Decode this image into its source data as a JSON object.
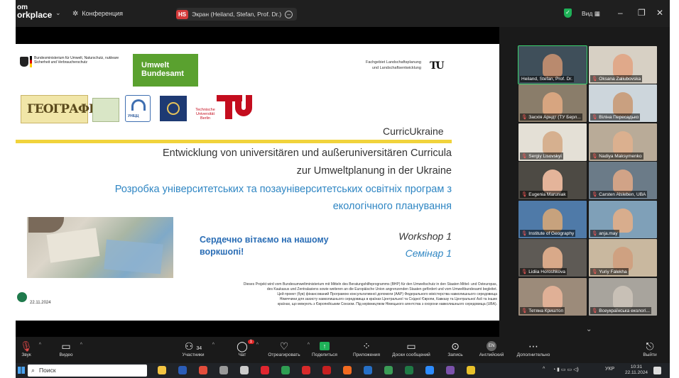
{
  "app": {
    "brand_line1": "om",
    "brand_line2": "orkplace",
    "meeting_label": "Конференция",
    "share_badge": "HS",
    "share_title": "Экран (Heiland, Stefan, Prof. Dr.)",
    "view_label": "Вид"
  },
  "slide": {
    "bmu_text": "Bundesministerium für Umwelt, Naturschutz, nukleare Sicherheit und Verbraucherschutz",
    "uba_line1": "Umwelt",
    "uba_line2": "Bundesamt",
    "fg_line1": "Fachgebiet Landschaftsplanung",
    "fg_line2": "und Landschaftsentwicklung",
    "tub_small": "TU",
    "geo_logo": "ГЕОГРАФІ",
    "logo_b_text": "УНІЦЦ",
    "tu_text": "Technische Universität Berlin",
    "curric": "CurricUkraine",
    "de_line1": "Entwicklung von universitären und außeruniversitären Curricula",
    "de_line2": "zur Umweltplanung in der Ukraine",
    "ua_line1": "Розробка університетських та позауніверситетських освітніх програм з",
    "ua_line2": "екологічного планування",
    "welcome_line1": "Сердечно вітаємо на нашому",
    "welcome_line2": "воркшопі!",
    "workshop_de": "Workshop 1",
    "workshop_ua": "Семінар 1",
    "fine_1": "Dieses Projekt wird vom Bundesumweltministerium mit Mitteln des Beratungshilfeprogramms (BHP) für den Umweltschutz in den Staaten Mittel- und Osteuropas,",
    "fine_2": "des Kaukasus und Zentralasiens sowie weiteren an die Europäische Union angrenzenden Staaten gefördert und vom Umweltbundesamt begleitet.",
    "fine_3": "Цей проект (був) фінансований Програмою консультативної допомоги (ААР) Федерального міністерства навколишнього середовища",
    "fine_4": "Німеччини для захисту навколишнього середовища в країнах Центральної та Східної Європи, Кавказу та Центральної Азії та інших",
    "fine_5": "країнах, що межують з Європейським Союзом. Під керівництвом Німецького агентства з охорони навколишнього середовища (UBA).",
    "date": "22.11.2024"
  },
  "participants": [
    {
      "name": "Heiland, Stefan, Prof. Dr.",
      "muted": false,
      "bg": "#3f4f5a",
      "face": "#b98a6e"
    },
    {
      "name": "Oksana Zaliubovska",
      "muted": true,
      "bg": "#d7d0c4",
      "face": "#e0a98a"
    },
    {
      "name": "Засхія Арндт (ТУ Берл...",
      "muted": true,
      "bg": "#8a7d6a",
      "face": "#d7a580"
    },
    {
      "name": "Віліна Пересадько",
      "muted": true,
      "bg": "#cdd6dc",
      "face": "#c9a080"
    },
    {
      "name": "Sergiy Lisovskyi",
      "muted": true,
      "bg": "#e4e0d6",
      "face": "#d6b08f"
    },
    {
      "name": "Nadiya Maksymenko",
      "muted": true,
      "bg": "#b9ab98",
      "face": "#dbb08f"
    },
    {
      "name": "Eugenia Maruniak",
      "muted": true,
      "bg": "#4d4a44",
      "face": "#e4b49a"
    },
    {
      "name": "Carsten Alsleben, UBA",
      "muted": true,
      "bg": "#6b7b88",
      "face": "#d1a387"
    },
    {
      "name": "Institute of Geography",
      "muted": true,
      "bg": "#4f7aa8",
      "face": "#c7a27d"
    },
    {
      "name": "anja.may",
      "muted": true,
      "bg": "#7fa0b8",
      "face": "#d8ad8d"
    },
    {
      "name": "Lidiia Horoshkova",
      "muted": true,
      "bg": "#5e5a55",
      "face": "#d9a989"
    },
    {
      "name": "Yuriy Falekha",
      "muted": true,
      "bg": "#c9b89f",
      "face": "#cfa181"
    },
    {
      "name": "Тетяна Криштоп",
      "muted": true,
      "bg": "#9c8b7a",
      "face": "#e0b096"
    },
    {
      "name": "Всеукраїнська екологі...",
      "muted": true,
      "bg": "#a8a49d",
      "face": "#c8c0b6"
    }
  ],
  "toolbar": {
    "audio": "Звук",
    "video": "Видео",
    "participants": "Участники",
    "participants_count": "34",
    "chat": "Чат",
    "chat_badge": "1",
    "react": "Отреагировать",
    "share": "Поделиться",
    "apps": "Приложения",
    "whiteboards": "Доски сообщений",
    "record": "Запись",
    "language": "Английский",
    "language_code": "EN",
    "more": "Дополнительно",
    "leave": "Выйти"
  },
  "taskbar": {
    "search": "Поиск",
    "lang": "УКР",
    "time": "10:31",
    "date": "22.11.2024",
    "apps": [
      {
        "name": "file-explorer",
        "color": "#f4c542"
      },
      {
        "name": "word",
        "color": "#2b5db8"
      },
      {
        "name": "chrome",
        "color": "#e34d3b"
      },
      {
        "name": "settings-app",
        "color": "#999999"
      },
      {
        "name": "gear-app",
        "color": "#cccccc"
      },
      {
        "name": "opera",
        "color": "#e0262f"
      },
      {
        "name": "chrome-2",
        "color": "#2f9e52"
      },
      {
        "name": "acrobat",
        "color": "#d82a2a"
      },
      {
        "name": "acrobat-2",
        "color": "#c62020"
      },
      {
        "name": "firefox",
        "color": "#f26b21"
      },
      {
        "name": "outlook",
        "color": "#2670c7"
      },
      {
        "name": "chrome-3",
        "color": "#3a9c56"
      },
      {
        "name": "excel",
        "color": "#1f7a45"
      },
      {
        "name": "zoom",
        "color": "#2d8cff"
      },
      {
        "name": "viber",
        "color": "#7b52ab"
      },
      {
        "name": "chrome-4",
        "color": "#e8c12a"
      }
    ]
  }
}
